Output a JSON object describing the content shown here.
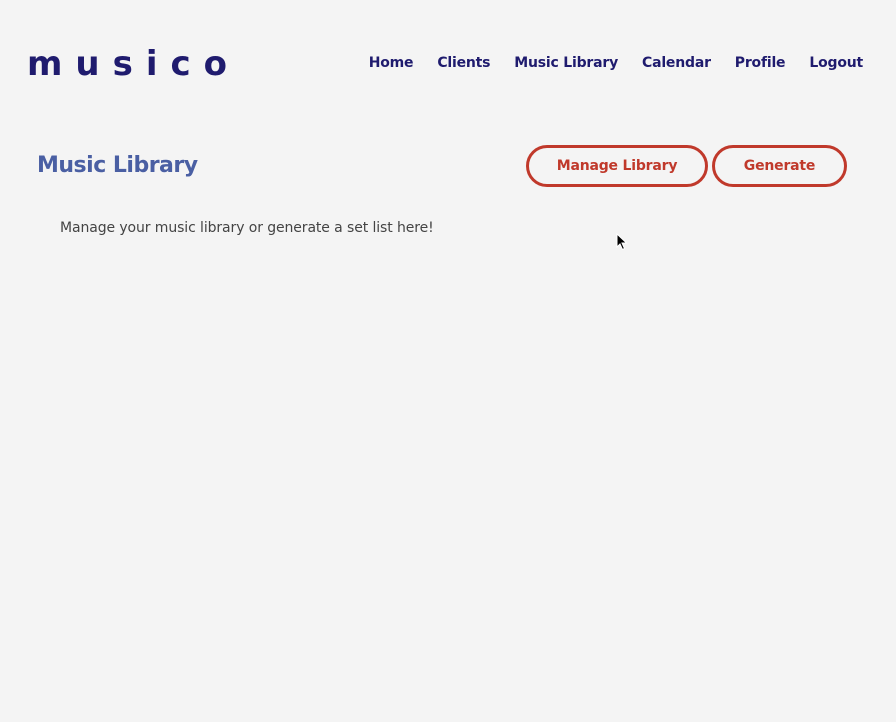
{
  "header": {
    "logo": "musico",
    "nav": [
      {
        "label": "Home"
      },
      {
        "label": "Clients"
      },
      {
        "label": "Music Library"
      },
      {
        "label": "Calendar"
      },
      {
        "label": "Profile"
      },
      {
        "label": "Logout"
      }
    ]
  },
  "main": {
    "title": "Music Library",
    "manage_button": "Manage Library",
    "generate_button": "Generate",
    "description": "Manage your music library or generate a set list here!"
  },
  "colors": {
    "brand": "#1f1b6e",
    "title": "#4a5fa3",
    "accent": "#c0392b",
    "background": "#f4f4f4"
  },
  "icons": {
    "cursor": "mouse-pointer-icon"
  }
}
